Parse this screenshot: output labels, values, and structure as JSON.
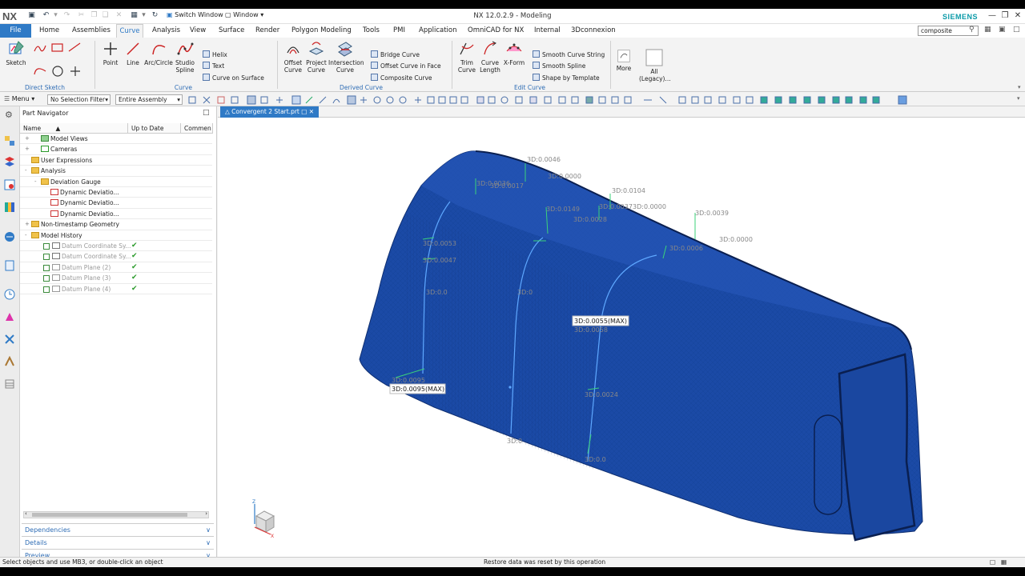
{
  "app": {
    "logo": "NX",
    "title": "NX 12.0.2.9 - Modeling",
    "brand": "SIEMENS"
  },
  "quick_access": {
    "switch_window": "Switch Window",
    "window": "Window"
  },
  "tabs": [
    "File",
    "Home",
    "Assemblies",
    "Curve",
    "Analysis",
    "View",
    "Surface",
    "Render",
    "Polygon Modeling",
    "Tools",
    "PMI",
    "Application",
    "OmniCAD for NX",
    "Internal",
    "3Dconnexion"
  ],
  "active_tab": "Curve",
  "command_search": {
    "value": "composite"
  },
  "ribbon": {
    "direct_sketch": {
      "sketch": "Sketch",
      "group": "Direct Sketch"
    },
    "curve": {
      "point": "Point",
      "line": "Line",
      "arc": "Arc/Circle",
      "studio_spline": "Studio Spline",
      "helix": "Helix",
      "text": "Text",
      "curve_on_surface": "Curve on Surface",
      "group": "Curve"
    },
    "derived_curve": {
      "offset": "Offset Curve",
      "project": "Project Curve",
      "intersection": "Intersection Curve",
      "bridge": "Bridge Curve",
      "offset_in_face": "Offset Curve in Face",
      "composite": "Composite Curve",
      "group": "Derived Curve"
    },
    "edit_curve": {
      "trim": "Trim Curve",
      "length": "Curve Length",
      "xform": "X-Form",
      "smooth_string": "Smooth Curve String",
      "smooth_spline": "Smooth Spline",
      "shape_template": "Shape by Template",
      "group": "Edit Curve"
    },
    "more": "More",
    "all_legacy": "All (Legacy)..."
  },
  "selection_bar": {
    "menu": "Menu",
    "filter": "No Selection Filter",
    "scope": "Entire Assembly"
  },
  "navigator": {
    "title": "Part Navigator",
    "columns": [
      "Name",
      "Up to Date",
      "Commen"
    ],
    "rows": [
      {
        "label": "Model Views",
        "check": false
      },
      {
        "label": "Cameras",
        "check": false
      },
      {
        "label": "User Expressions",
        "check": false
      },
      {
        "label": "Analysis",
        "check": false
      },
      {
        "label": "Deviation Gauge",
        "check": false
      },
      {
        "label": "Dynamic Deviatio...",
        "check": false
      },
      {
        "label": "Dynamic Deviatio...",
        "check": false
      },
      {
        "label": "Dynamic Deviatio...",
        "check": false
      },
      {
        "label": "Non-timestamp Geometry",
        "check": false
      },
      {
        "label": "Model History",
        "check": false
      },
      {
        "label": "Datum Coordinate Sy...",
        "check": true
      },
      {
        "label": "Datum Coordinate Sy...",
        "check": true
      },
      {
        "label": "Datum Plane (2)",
        "check": true
      },
      {
        "label": "Datum Plane (3)",
        "check": true
      },
      {
        "label": "Datum Plane (4)",
        "check": true
      }
    ],
    "panels": [
      "Dependencies",
      "Details",
      "Preview"
    ]
  },
  "document_tab": "Convergent 2 Start.prt",
  "deviation_labels": [
    "3D:0.0046",
    "3D:0.0000",
    "3D:0.0036",
    "3D:0.0017",
    "3D:0.0104",
    "3D:0.0149",
    "3D:0.0037",
    "3D:0.0000",
    "3D:0.0028",
    "3D:0.0039",
    "3D:0.0000",
    "3D:0.0053",
    "3D:0.0006",
    "3D:0.0047",
    "3D:0.0",
    "3D:0",
    "3D:0.0055(MAX)",
    "3D:0.0058",
    "3D:0.0095",
    "3D:0.0095(MAX)",
    "3D:0.0024",
    "3D:0.0",
    "3D:0"
  ],
  "triad": {
    "z": "Z",
    "x": "X"
  },
  "status": {
    "left": "Select objects and use MB3, or double-click an object",
    "center": "Restore data was reset by this operation"
  },
  "colors": {
    "accent": "#2f7ac6",
    "model": "#1a4aa6",
    "mesh_dark": "#133a8a"
  }
}
